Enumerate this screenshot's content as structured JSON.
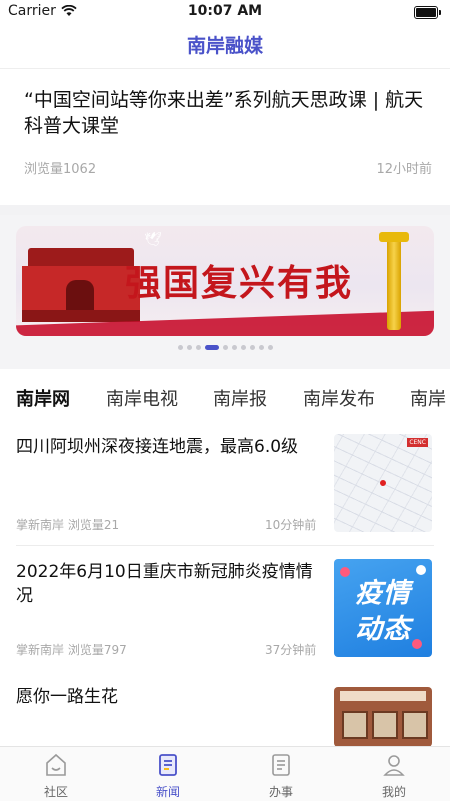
{
  "status_bar": {
    "carrier": "Carrier",
    "time": "10:07 AM"
  },
  "app_title": "南岸融媒",
  "featured": {
    "title": "“中国空间站等你来出差”系列航天思政课 | 航天科普大课堂",
    "views": "浏览量1062",
    "time": "12小时前"
  },
  "banner": {
    "text": "强国复兴有我",
    "dot_count": 10,
    "active_dot": 3
  },
  "channel_tabs": [
    {
      "label": "南岸网",
      "active": true
    },
    {
      "label": "南岸电视",
      "active": false
    },
    {
      "label": "南岸报",
      "active": false
    },
    {
      "label": "南岸发布",
      "active": false
    },
    {
      "label": "南岸",
      "active": false
    }
  ],
  "news": [
    {
      "title": "四川阿坝州深夜接连地震，最高6.0级",
      "source": "掌新南岸",
      "views": "浏览量21",
      "time": "10分钟前",
      "thumb_icon": "earthquake-map-thumbnail"
    },
    {
      "title": "2022年6月10日重庆市新冠肺炎疫情情况",
      "source": "掌新南岸",
      "views": "浏览量797",
      "time": "37分钟前",
      "thumb_icon": "epidemic-update-thumbnail",
      "thumb_line1": "疫情",
      "thumb_line2": "动态"
    },
    {
      "title": "愿你一路生花",
      "thumb_icon": "classroom-thumbnail"
    }
  ],
  "bottom_tabs": [
    {
      "label": "社区",
      "icon": "community-home-icon",
      "active": false
    },
    {
      "label": "新闻",
      "icon": "news-document-icon",
      "active": true
    },
    {
      "label": "办事",
      "icon": "services-clipboard-icon",
      "active": false
    },
    {
      "label": "我的",
      "icon": "profile-person-icon",
      "active": false
    }
  ],
  "colors": {
    "accent": "#4a52c9",
    "tab_highlight": "#ffd93b",
    "banner_red": "#c4161c"
  }
}
